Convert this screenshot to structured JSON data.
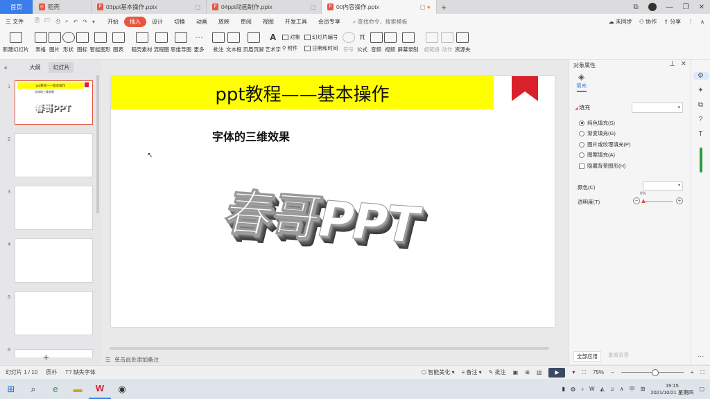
{
  "tabs": [
    {
      "label": "首页",
      "kind": "home"
    },
    {
      "label": "稻壳",
      "kind": "doc"
    },
    {
      "label": "03ppt基本操作.pptx",
      "kind": "file"
    },
    {
      "label": "04ppt动画制作.pptx",
      "kind": "file"
    },
    {
      "label": "00内容操作.pptx",
      "kind": "file",
      "active": true
    }
  ],
  "menu": {
    "file": "三 文件",
    "items": [
      "开始",
      "插入",
      "设计",
      "切换",
      "动画",
      "放映",
      "审阅",
      "视图",
      "开发工具",
      "会员专享"
    ],
    "active": "插入",
    "search": "查找命令、搜索模板",
    "sync": "未同步",
    "collab": "协作",
    "share": "分享"
  },
  "ribbon": {
    "new_slide": "新建幻灯片",
    "table": "表格",
    "picture": "图片",
    "shape": "形状",
    "icon": "图标",
    "smart_graphic": "智能图形",
    "chart": "图表",
    "docer_material": "稻壳素材",
    "flowchart": "流程图",
    "mindmap": "思维导图",
    "more": "更多",
    "comment": "批注",
    "textbox": "文本框",
    "header_footer": "页眉页脚",
    "wordart": "艺术字",
    "object": "对象",
    "slide_number": "幻灯片编号",
    "attachment": "附件",
    "datetime": "日期和时间",
    "symbol": "符号",
    "formula": "公式",
    "audio": "音频",
    "video": "视频",
    "screen_record": "屏幕录制",
    "hyperlink": "超链接",
    "action": "动作",
    "resource": "资源夹"
  },
  "left_pane": {
    "outline_tab": "大纲",
    "slides_tab": "幻灯片",
    "slide_numbers": [
      "1",
      "2",
      "3",
      "4",
      "5",
      "6"
    ],
    "thumb1_title": "ppt教程——基本操作",
    "thumb1_sub": "字体的三维效果",
    "thumb1_art": "春哥PPT"
  },
  "slide": {
    "title": "ppt教程——基本操作",
    "subtitle": "字体的三维效果",
    "wordart": "春哥PPT",
    "title_bg": "#ffff00",
    "flag_color": "#d9202b"
  },
  "notes_placeholder": "单击此处添加备注",
  "right_pane": {
    "title": "对象属性",
    "tab_fill": "填充",
    "fill_header": "填充",
    "options": [
      "纯色填充(S)",
      "渐变填充(G)",
      "图片或纹理填充(P)",
      "图案填充(A)"
    ],
    "hide_bg": "隐藏背景图形(H)",
    "color_label": "颜色(C)",
    "transparency_label": "透明度(T)",
    "transparency_value": "0%",
    "apply_all": "全部应用",
    "reset_bg": "重置背景"
  },
  "status": {
    "slide_pos": "幻灯片 1 / 10",
    "theme": "质朴",
    "missing_font": "缺失字体",
    "smart_beautify": "智能美化",
    "notes": "备注",
    "comments": "批注",
    "zoom": "75%"
  },
  "taskbar": {
    "time": "19:15",
    "date": "2021/10/21 星期四",
    "ime": "中"
  },
  "colors": {
    "accent": "#e8563f",
    "brand_blue": "#3b7de9"
  }
}
